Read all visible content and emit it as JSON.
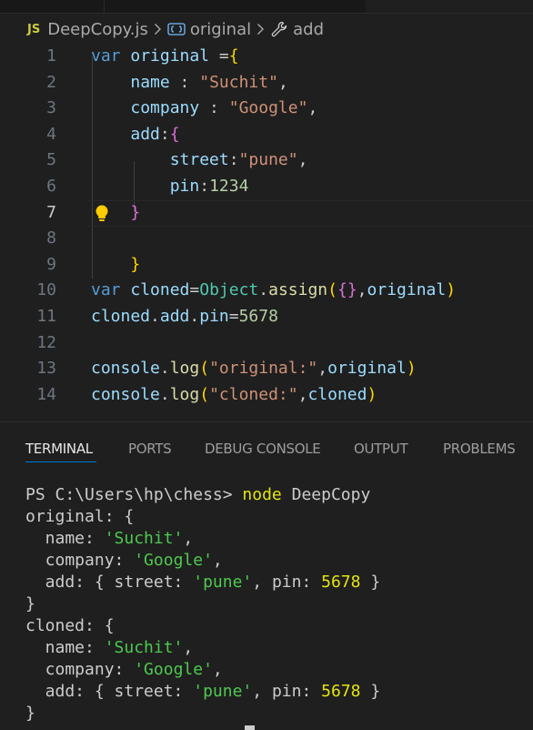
{
  "breadcrumb": {
    "lang_badge": "JS",
    "file": "DeepCopy.js",
    "symbol1": "original",
    "symbol2": "add",
    "icons": {
      "symbol1": "object-symbol-icon",
      "symbol2": "wrench-icon",
      "separator": "chevron-right-icon",
      "hint": "lightbulb-icon"
    }
  },
  "editor": {
    "current_line": 7,
    "lines": [
      {
        "n": "1",
        "tokens": [
          [
            "kw",
            "var"
          ],
          [
            "p",
            " "
          ],
          [
            "var",
            "original"
          ],
          [
            "p",
            " ="
          ],
          [
            "b1",
            "{"
          ]
        ]
      },
      {
        "n": "2",
        "tokens": [
          [
            "p",
            "    "
          ],
          [
            "var",
            "name"
          ],
          [
            "p",
            " : "
          ],
          [
            "str",
            "\"Suchit\""
          ],
          [
            "p",
            ","
          ]
        ]
      },
      {
        "n": "3",
        "tokens": [
          [
            "p",
            "    "
          ],
          [
            "var",
            "company"
          ],
          [
            "p",
            " : "
          ],
          [
            "str",
            "\"Google\""
          ],
          [
            "p",
            ","
          ]
        ]
      },
      {
        "n": "4",
        "tokens": [
          [
            "p",
            "    "
          ],
          [
            "var",
            "add"
          ],
          [
            "p",
            ":"
          ],
          [
            "b2",
            "{"
          ]
        ]
      },
      {
        "n": "5",
        "tokens": [
          [
            "p",
            "        "
          ],
          [
            "var",
            "street"
          ],
          [
            "p",
            ":"
          ],
          [
            "str",
            "\"pune\""
          ],
          [
            "p",
            ","
          ]
        ]
      },
      {
        "n": "6",
        "tokens": [
          [
            "p",
            "        "
          ],
          [
            "var",
            "pin"
          ],
          [
            "p",
            ":"
          ],
          [
            "num",
            "1234"
          ]
        ]
      },
      {
        "n": "7",
        "tokens": [
          [
            "p",
            "    "
          ],
          [
            "b2",
            "}"
          ]
        ]
      },
      {
        "n": "8",
        "tokens": []
      },
      {
        "n": "9",
        "tokens": [
          [
            "p",
            "    "
          ],
          [
            "b1",
            "}"
          ]
        ]
      },
      {
        "n": "10",
        "tokens": [
          [
            "kw",
            "var"
          ],
          [
            "p",
            " "
          ],
          [
            "var",
            "cloned"
          ],
          [
            "p",
            "="
          ],
          [
            "cls",
            "Object"
          ],
          [
            "p",
            "."
          ],
          [
            "fn",
            "assign"
          ],
          [
            "b1",
            "("
          ],
          [
            "b2",
            "{}"
          ],
          [
            "p",
            ","
          ],
          [
            "var",
            "original"
          ],
          [
            "b1",
            ")"
          ]
        ]
      },
      {
        "n": "11",
        "tokens": [
          [
            "var",
            "cloned"
          ],
          [
            "p",
            "."
          ],
          [
            "var",
            "add"
          ],
          [
            "p",
            "."
          ],
          [
            "var",
            "pin"
          ],
          [
            "p",
            "="
          ],
          [
            "num",
            "5678"
          ]
        ]
      },
      {
        "n": "12",
        "tokens": []
      },
      {
        "n": "13",
        "tokens": [
          [
            "var",
            "console"
          ],
          [
            "p",
            "."
          ],
          [
            "fn",
            "log"
          ],
          [
            "b1",
            "("
          ],
          [
            "str",
            "\"original:\""
          ],
          [
            "p",
            ","
          ],
          [
            "var",
            "original"
          ],
          [
            "b1",
            ")"
          ]
        ]
      },
      {
        "n": "14",
        "tokens": [
          [
            "var",
            "console"
          ],
          [
            "p",
            "."
          ],
          [
            "fn",
            "log"
          ],
          [
            "b1",
            "("
          ],
          [
            "str",
            "\"cloned:\""
          ],
          [
            "p",
            ","
          ],
          [
            "var",
            "cloned"
          ],
          [
            "b1",
            ")"
          ]
        ]
      }
    ]
  },
  "panel": {
    "tabs": [
      {
        "label": "TERMINAL",
        "active": true
      },
      {
        "label": "PORTS",
        "active": false
      },
      {
        "label": "DEBUG CONSOLE",
        "active": false
      },
      {
        "label": "OUTPUT",
        "active": false
      },
      {
        "label": "PROBLEMS",
        "active": false
      }
    ]
  },
  "terminal": {
    "lines": [
      [
        [
          "p",
          "PS C:\\Users\\hp\\chess> "
        ],
        [
          "y",
          "node"
        ],
        [
          "p",
          " DeepCopy"
        ]
      ],
      [
        [
          "p",
          "original: {"
        ]
      ],
      [
        [
          "p",
          "  name: "
        ],
        [
          "g",
          "'Suchit'"
        ],
        [
          "p",
          ","
        ]
      ],
      [
        [
          "p",
          "  company: "
        ],
        [
          "g",
          "'Google'"
        ],
        [
          "p",
          ","
        ]
      ],
      [
        [
          "p",
          "  add: { street: "
        ],
        [
          "g",
          "'pune'"
        ],
        [
          "p",
          ", pin: "
        ],
        [
          "n",
          "5678"
        ],
        [
          "p",
          " }"
        ]
      ],
      [
        [
          "p",
          "}"
        ]
      ],
      [
        [
          "p",
          "cloned: {"
        ]
      ],
      [
        [
          "p",
          "  name: "
        ],
        [
          "g",
          "'Suchit'"
        ],
        [
          "p",
          ","
        ]
      ],
      [
        [
          "p",
          "  company: "
        ],
        [
          "g",
          "'Google'"
        ],
        [
          "p",
          ","
        ]
      ],
      [
        [
          "p",
          "  add: { street: "
        ],
        [
          "g",
          "'pune'"
        ],
        [
          "p",
          ", pin: "
        ],
        [
          "n",
          "5678"
        ],
        [
          "p",
          " }"
        ]
      ],
      [
        [
          "p",
          "}"
        ]
      ]
    ]
  }
}
